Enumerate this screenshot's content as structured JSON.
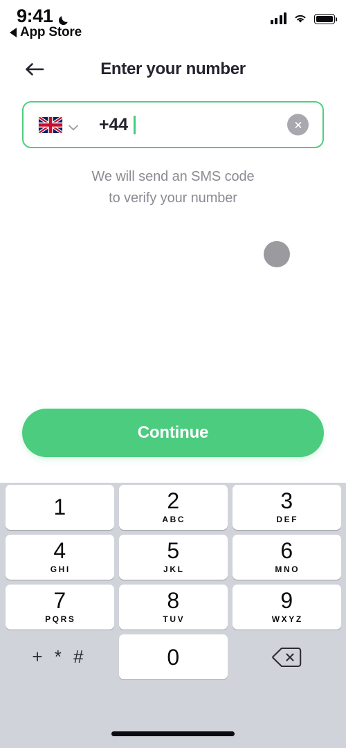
{
  "status_bar": {
    "time": "9:41",
    "dnd_icon": "moon-icon",
    "back_app_label": "App Store",
    "back_app_icon": "triangle-left-icon",
    "signal_icon": "cellular-signal-icon",
    "wifi_icon": "wifi-icon",
    "battery_icon": "battery-full-icon"
  },
  "nav": {
    "back_icon": "arrow-left-icon",
    "title": "Enter your number"
  },
  "phone_input": {
    "country_flag": "flag-uk-icon",
    "country_chevron": "chevron-down-icon",
    "dial_code": "+44",
    "value": "",
    "clear_icon": "close-circle-icon",
    "border_color": "#4ccf80",
    "caret_color": "#3fcf7a"
  },
  "helper": {
    "line1": "We will send an SMS code",
    "line2": "to verify your number"
  },
  "touch_indicator": {
    "name": "touch-point-indicator",
    "color": "#9a9a9f"
  },
  "primary_action": {
    "label": "Continue",
    "color": "#4bcc7f",
    "text_color": "#ffffff"
  },
  "keypad": {
    "background": "#d1d3da",
    "rows": [
      [
        {
          "digit": "1",
          "letters": ""
        },
        {
          "digit": "2",
          "letters": "ABC"
        },
        {
          "digit": "3",
          "letters": "DEF"
        }
      ],
      [
        {
          "digit": "4",
          "letters": "GHI"
        },
        {
          "digit": "5",
          "letters": "JKL"
        },
        {
          "digit": "6",
          "letters": "MNO"
        }
      ],
      [
        {
          "digit": "7",
          "letters": "PQRS"
        },
        {
          "digit": "8",
          "letters": "TUV"
        },
        {
          "digit": "9",
          "letters": "WXYZ"
        }
      ]
    ],
    "symbols_key": "+ * #",
    "zero_key": {
      "digit": "0",
      "letters": ""
    },
    "delete_icon": "backspace-icon"
  },
  "home_indicator": "home-indicator"
}
